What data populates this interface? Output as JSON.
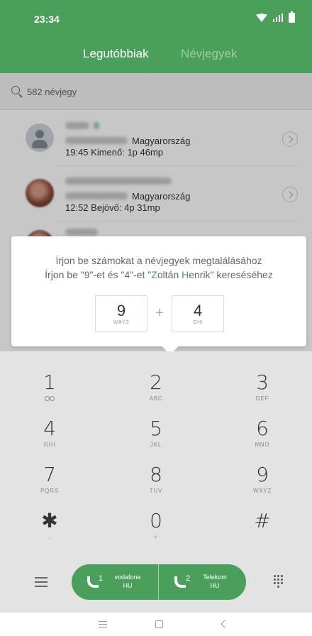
{
  "status_bar": {
    "time": "23:34"
  },
  "tabs": {
    "recent": "Legutóbbiak",
    "contacts": "Névjegyek"
  },
  "search": {
    "placeholder": "582 névjegy"
  },
  "contacts": [
    {
      "country": "Magyarország",
      "meta": "19:45 Kimenő: 1p 46mp"
    },
    {
      "country": "Magyarország",
      "meta": "12:52 Bejövő: 4p 31mp"
    }
  ],
  "tooltip": {
    "line1": "Írjon be számokat a névjegyek megtalálásához",
    "line2_prefix": "Írjon be \"9\"-et és \"4\"-et \"",
    "line2_z": "Z",
    "line2_mid1": "oltán ",
    "line2_h": "H",
    "line2_mid2": "enrik\" kereséséhez",
    "key1": {
      "digit": "9",
      "letters": "WXYZ"
    },
    "plus": "+",
    "key2": {
      "digit": "4",
      "letters": "GHI"
    }
  },
  "keypad": [
    {
      "digit": "1",
      "letters": ""
    },
    {
      "digit": "2",
      "letters": "ABC"
    },
    {
      "digit": "3",
      "letters": "DEF"
    },
    {
      "digit": "4",
      "letters": "GHI"
    },
    {
      "digit": "5",
      "letters": "JKL"
    },
    {
      "digit": "6",
      "letters": "MNO"
    },
    {
      "digit": "7",
      "letters": "PQRS"
    },
    {
      "digit": "8",
      "letters": "TUV"
    },
    {
      "digit": "9",
      "letters": "WXYZ"
    },
    {
      "digit": "✱",
      "letters": ","
    },
    {
      "digit": "0",
      "letters": "+"
    },
    {
      "digit": "#",
      "letters": ""
    }
  ],
  "call": {
    "sim1_num": "1",
    "sim1_name": "vodafone",
    "sim1_country": "HU",
    "sim2_num": "2",
    "sim2_name": "Telekom",
    "sim2_country": "HU"
  },
  "colors": {
    "accent": "#4aa05a"
  }
}
